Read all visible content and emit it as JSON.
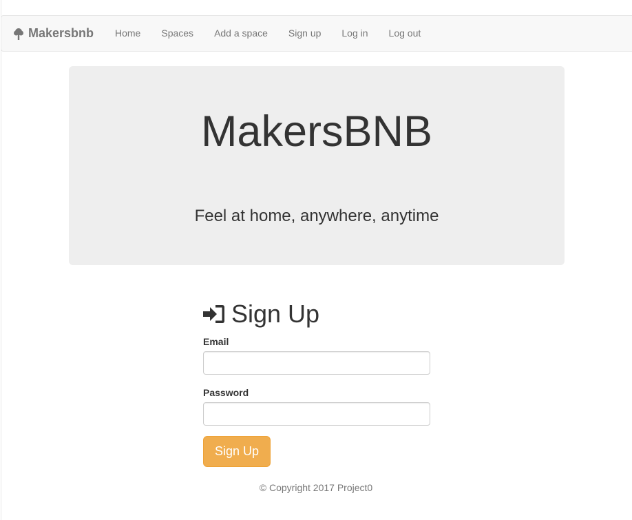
{
  "navbar": {
    "brand": "Makersbnb",
    "brand_icon": "tree-icon",
    "links": [
      {
        "label": "Home"
      },
      {
        "label": "Spaces"
      },
      {
        "label": "Add a space"
      },
      {
        "label": "Sign up"
      },
      {
        "label": "Log in"
      },
      {
        "label": "Log out"
      }
    ]
  },
  "hero": {
    "title": "MakersBNB",
    "tagline": "Feel at home, anywhere, anytime"
  },
  "signup": {
    "heading": "Sign Up",
    "heading_icon": "sign-in-icon",
    "email_label": "Email",
    "email_value": "",
    "password_label": "Password",
    "password_value": "",
    "submit_label": "Sign Up"
  },
  "footer": {
    "copyright": "© Copyright 2017 Project0"
  },
  "colors": {
    "navbar_bg": "#f8f8f8",
    "hero_bg": "#eeeeee",
    "button_warning": "#f0ad4e",
    "muted_text": "#777777"
  }
}
